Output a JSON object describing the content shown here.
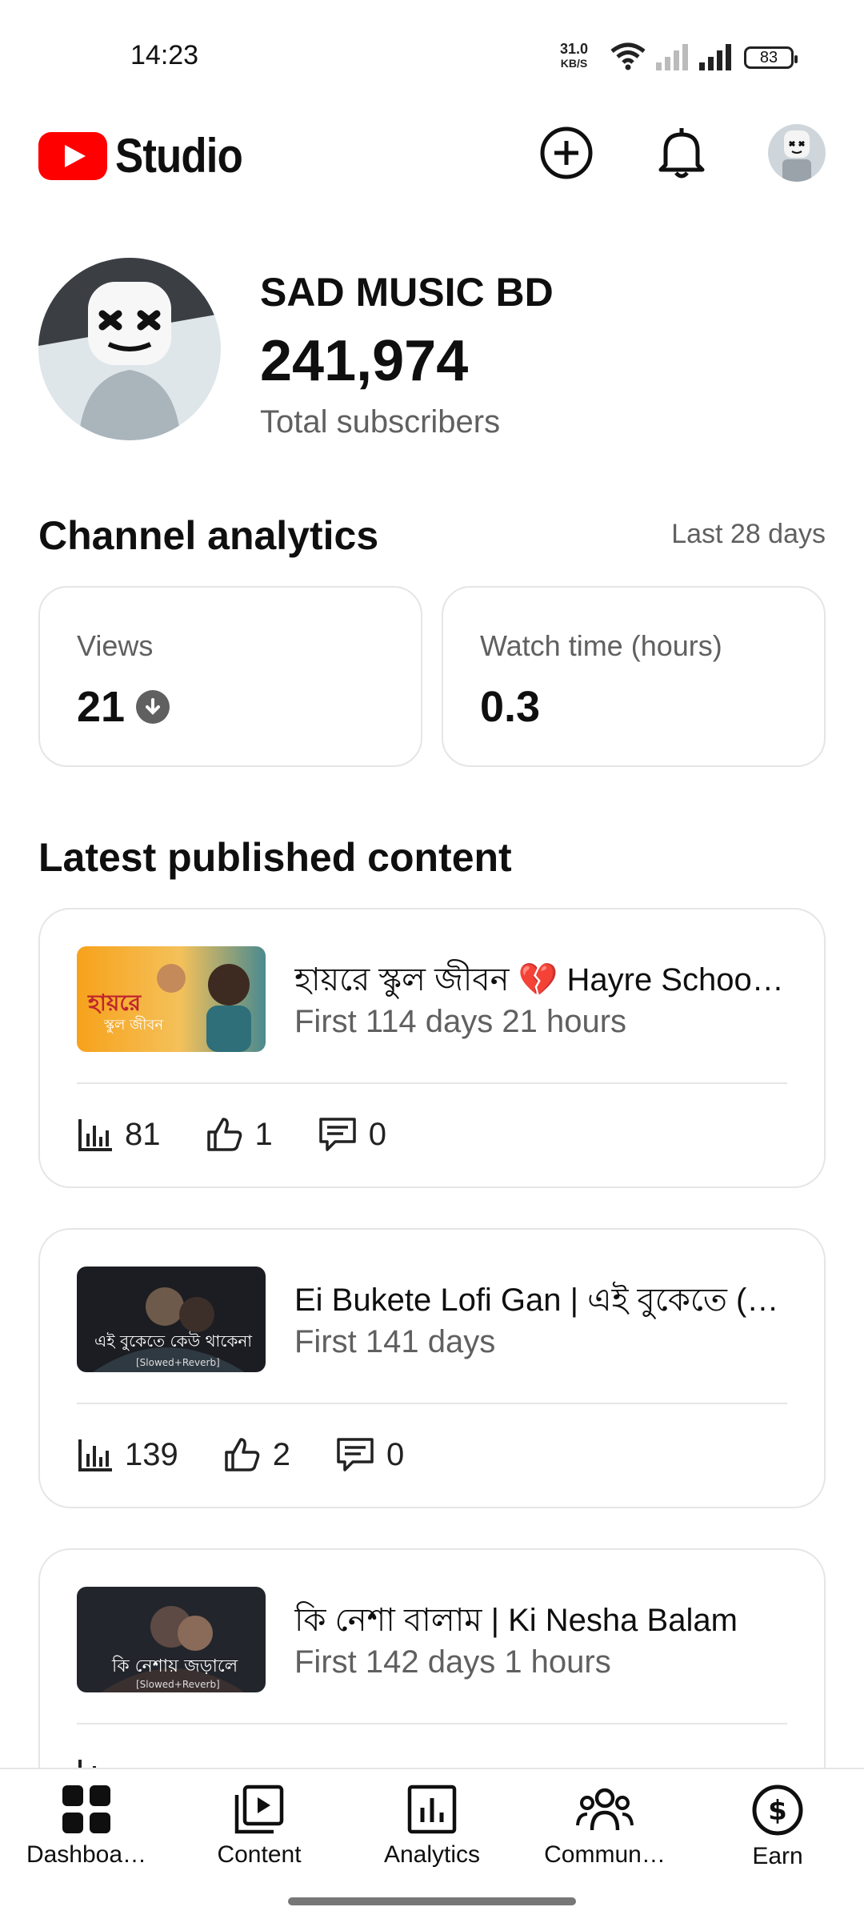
{
  "status_bar": {
    "time": "14:23",
    "net_speed": "31.0",
    "net_unit": "KB/S",
    "battery": "83"
  },
  "header": {
    "app_name": "Studio",
    "icons": [
      "create-icon",
      "notifications-icon",
      "account-avatar"
    ]
  },
  "channel": {
    "name": "SAD MUSIC BD",
    "subscribers": "241,974",
    "subscribers_label": "Total subscribers"
  },
  "analytics": {
    "title": "Channel analytics",
    "range": "Last 28 days",
    "cards": [
      {
        "label": "Views",
        "value": "21",
        "trend": "down"
      },
      {
        "label": "Watch time (hours)",
        "value": "0.3"
      }
    ]
  },
  "latest": {
    "title": "Latest published content",
    "items": [
      {
        "title": "হায়রে স্কুল জীবন 💔 Hayre School Jibon",
        "subtitle": "First 114 days 21 hours",
        "views": "81",
        "likes": "1",
        "comments": "0"
      },
      {
        "title": "Ei Bukete Lofi Gan | এই বুকেতে (কেউ থাকেনা)",
        "subtitle": "First 141 days",
        "views": "139",
        "likes": "2",
        "comments": "0"
      },
      {
        "title": "কি নেশা  বালাম | Ki Nesha  Balam",
        "subtitle": "First 142 days 1 hours",
        "views": "",
        "likes": "",
        "comments": ""
      }
    ]
  },
  "bottom_nav": {
    "items": [
      {
        "label": "Dashboa…",
        "icon": "dashboard-icon"
      },
      {
        "label": "Content",
        "icon": "content-icon"
      },
      {
        "label": "Analytics",
        "icon": "analytics-icon"
      },
      {
        "label": "Commun…",
        "icon": "community-icon"
      },
      {
        "label": "Earn",
        "icon": "earn-icon"
      }
    ]
  },
  "colors": {
    "brand_red": "#ff0000",
    "secondary_text": "#606060",
    "border": "#e5e5e5"
  }
}
